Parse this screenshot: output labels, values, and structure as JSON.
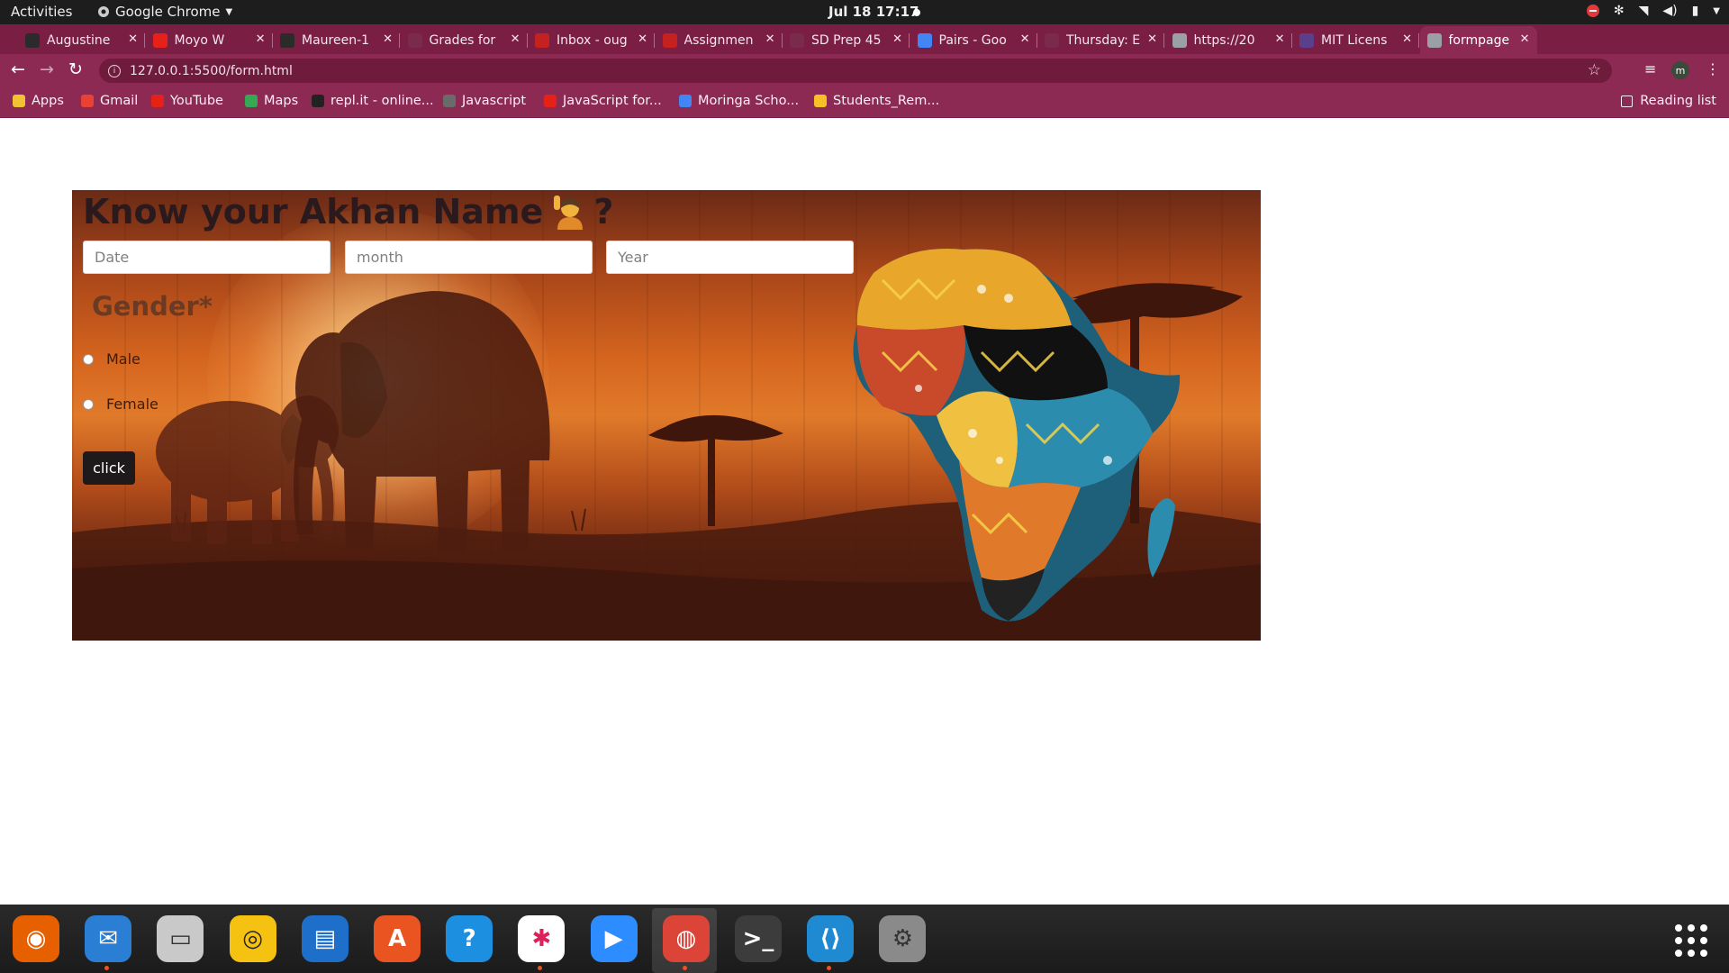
{
  "system_bar": {
    "activities": "Activities",
    "app_menu": "Google Chrome",
    "clock": "Jul 18  17:17"
  },
  "tabs": [
    {
      "title": "Augustine",
      "favicon_color": "#2b2b2b"
    },
    {
      "title": "Moyo W",
      "favicon_color": "#e62117"
    },
    {
      "title": "Maureen-1",
      "favicon_color": "#2b2b2b"
    },
    {
      "title": "Grades for",
      "favicon_color": "#7a2a4a"
    },
    {
      "title": "Inbox - oug",
      "favicon_color": "#c5221f"
    },
    {
      "title": "Assignmen",
      "favicon_color": "#c5221f"
    },
    {
      "title": "SD Prep 45",
      "favicon_color": "#7a2a4a"
    },
    {
      "title": "Pairs - Goo",
      "favicon_color": "#4285f4"
    },
    {
      "title": "Thursday: E",
      "favicon_color": "#7a2a4a"
    },
    {
      "title": "https://20",
      "favicon_color": "#9aa0a6"
    },
    {
      "title": "MIT Licens",
      "favicon_color": "#5b3f8c"
    },
    {
      "title": "formpage",
      "favicon_color": "#9aa0a6",
      "active": true
    }
  ],
  "toolbar": {
    "url": "127.0.0.1:5500/form.html"
  },
  "bookmarks": [
    {
      "label": "Apps",
      "color": "#f1c232"
    },
    {
      "label": "Gmail",
      "color": "#e94235"
    },
    {
      "label": "YouTube",
      "color": "#e62117"
    },
    {
      "label": "Maps",
      "color": "#34a853"
    },
    {
      "label": "repl.it - online...",
      "color": "#222222"
    },
    {
      "label": "Javascript",
      "color": "#6a6a6a"
    },
    {
      "label": "JavaScript for...",
      "color": "#e62117"
    },
    {
      "label": "Moringa Scho...",
      "color": "#4285f4"
    },
    {
      "label": "Students_Rem...",
      "color": "#f6c026"
    }
  ],
  "reading_list": "Reading list",
  "form": {
    "title": "Know your Akhan Name",
    "title_suffix": "?",
    "date_placeholder": "Date",
    "month_placeholder": "month",
    "year_placeholder": "Year",
    "gender_heading": "Gender*",
    "male_label": "Male",
    "female_label": "Female",
    "submit_label": "click"
  },
  "colors": {
    "chrome_frame": "#7b1e44",
    "chrome_toolbar": "#8d2a54",
    "form_text": "#2a1a1e"
  },
  "dock": [
    {
      "name": "firefox-icon",
      "color": "#e66000",
      "running": false
    },
    {
      "name": "thunderbird-icon",
      "color": "#2a7fd4",
      "running": true
    },
    {
      "name": "files-icon",
      "color": "#c9c9c9",
      "running": false
    },
    {
      "name": "rhythmbox-icon",
      "color": "#f5c211",
      "running": false
    },
    {
      "name": "writer-icon",
      "color": "#1e6fc9",
      "running": false
    },
    {
      "name": "software-icon",
      "color": "#e95420",
      "running": false
    },
    {
      "name": "help-icon",
      "color": "#1c8fe0",
      "running": false
    },
    {
      "name": "slack-icon",
      "color": "#ffffff",
      "running": true
    },
    {
      "name": "zoom-icon",
      "color": "#2d8cff",
      "running": false
    },
    {
      "name": "chrome-icon",
      "color": "#db4437",
      "running": true
    },
    {
      "name": "terminal-icon",
      "color": "#3c3c3c",
      "running": false
    },
    {
      "name": "vscode-icon",
      "color": "#1f8ad2",
      "running": true
    },
    {
      "name": "settings-icon",
      "color": "#8a8a8a",
      "running": false
    }
  ]
}
